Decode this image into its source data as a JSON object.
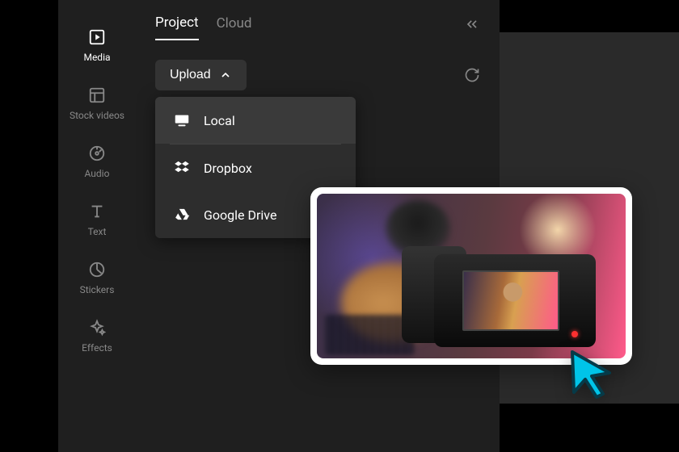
{
  "sidebar": {
    "items": [
      {
        "label": "Media",
        "icon": "play-square-icon"
      },
      {
        "label": "Stock videos",
        "icon": "layout-icon"
      },
      {
        "label": "Audio",
        "icon": "disc-icon"
      },
      {
        "label": "Text",
        "icon": "type-icon"
      },
      {
        "label": "Stickers",
        "icon": "clock-slice-icon"
      },
      {
        "label": "Effects",
        "icon": "sparkle-icon"
      }
    ],
    "active_index": 0
  },
  "tabs": {
    "items": [
      "Project",
      "Cloud"
    ],
    "active_index": 0
  },
  "upload": {
    "button_label": "Upload",
    "dropdown": [
      {
        "label": "Local",
        "icon": "monitor-icon"
      },
      {
        "label": "Dropbox",
        "icon": "dropbox-icon"
      },
      {
        "label": "Google Drive",
        "icon": "drive-icon"
      }
    ],
    "highlighted_index": 0
  },
  "icons": {
    "collapse": "chevrons-left-icon",
    "refresh": "refresh-icon",
    "chevron_up": "chevron-up-icon"
  },
  "preview": {
    "description": "thumbnail-camera-recording-musician"
  },
  "cursor": {
    "color_fill": "#00c4e8",
    "color_stroke": "#0a4a5a"
  }
}
